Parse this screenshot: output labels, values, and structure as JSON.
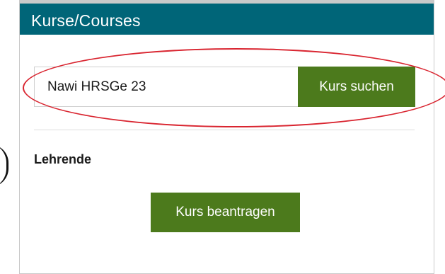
{
  "panel": {
    "title": "Kurse/Courses"
  },
  "search": {
    "value": "Nawi HRSGe 23",
    "button_label": "Kurs suchen"
  },
  "teachers": {
    "heading": "Lehrende",
    "request_button_label": "Kurs beantragen"
  },
  "colors": {
    "header_bg": "#006578",
    "button_bg": "#4c7a1c",
    "annotation": "#d92530"
  }
}
